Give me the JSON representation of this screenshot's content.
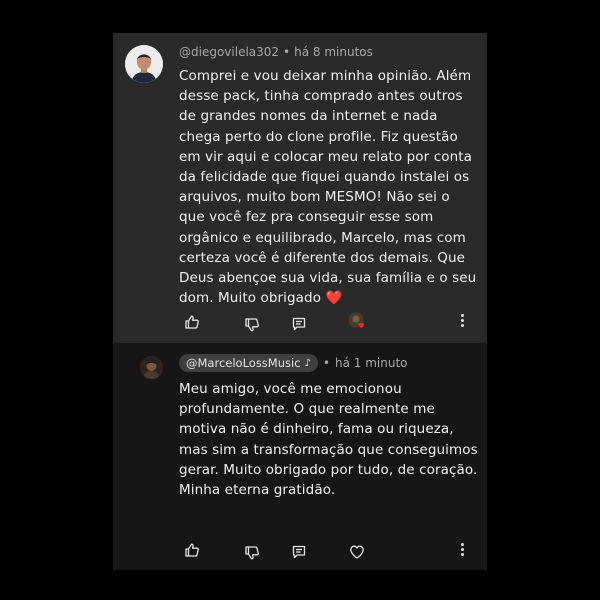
{
  "comment": {
    "username": "@diegovilela302",
    "separator": "•",
    "time": "há 8 minutos",
    "text": "Comprei e vou deixar minha opinião. Além desse pack, tinha comprado antes outros de grandes nomes da internet e nada chega perto do clone profile. Fiz questão em vir aqui e colocar meu relato por conta da felicidade que fiquei quando instalei os arquivos, muito bom MESMO! Não sei o que você fez pra conseguir esse som orgânico e equilibrado, Marcelo, mas com certeza você é diferente dos demais. Que Deus abençoe sua vida, sua família e o seu dom. Muito obrigado ❤️"
  },
  "reply": {
    "username": "@MarceloLossMusic",
    "badge_glyph": "♪",
    "separator": "•",
    "time": "há 1 minuto",
    "text": "Meu amigo, você me emocionou profundamente. O que realmente me motiva não é dinheiro, fama ou riqueza, mas sim a transformação que conseguimos gerar. Muito obrigado por tudo, de coração. Minha eterna gratidão."
  },
  "icons": {
    "like": "thumbs-up-icon",
    "dislike": "thumbs-down-icon",
    "reply": "reply-icon",
    "heart": "heart-icon",
    "more": "more-vertical-icon"
  },
  "colors": {
    "background": "#000000",
    "comment_bg": "#2a2a2a",
    "reply_bg": "#161616",
    "heart": "#e52a2a"
  }
}
